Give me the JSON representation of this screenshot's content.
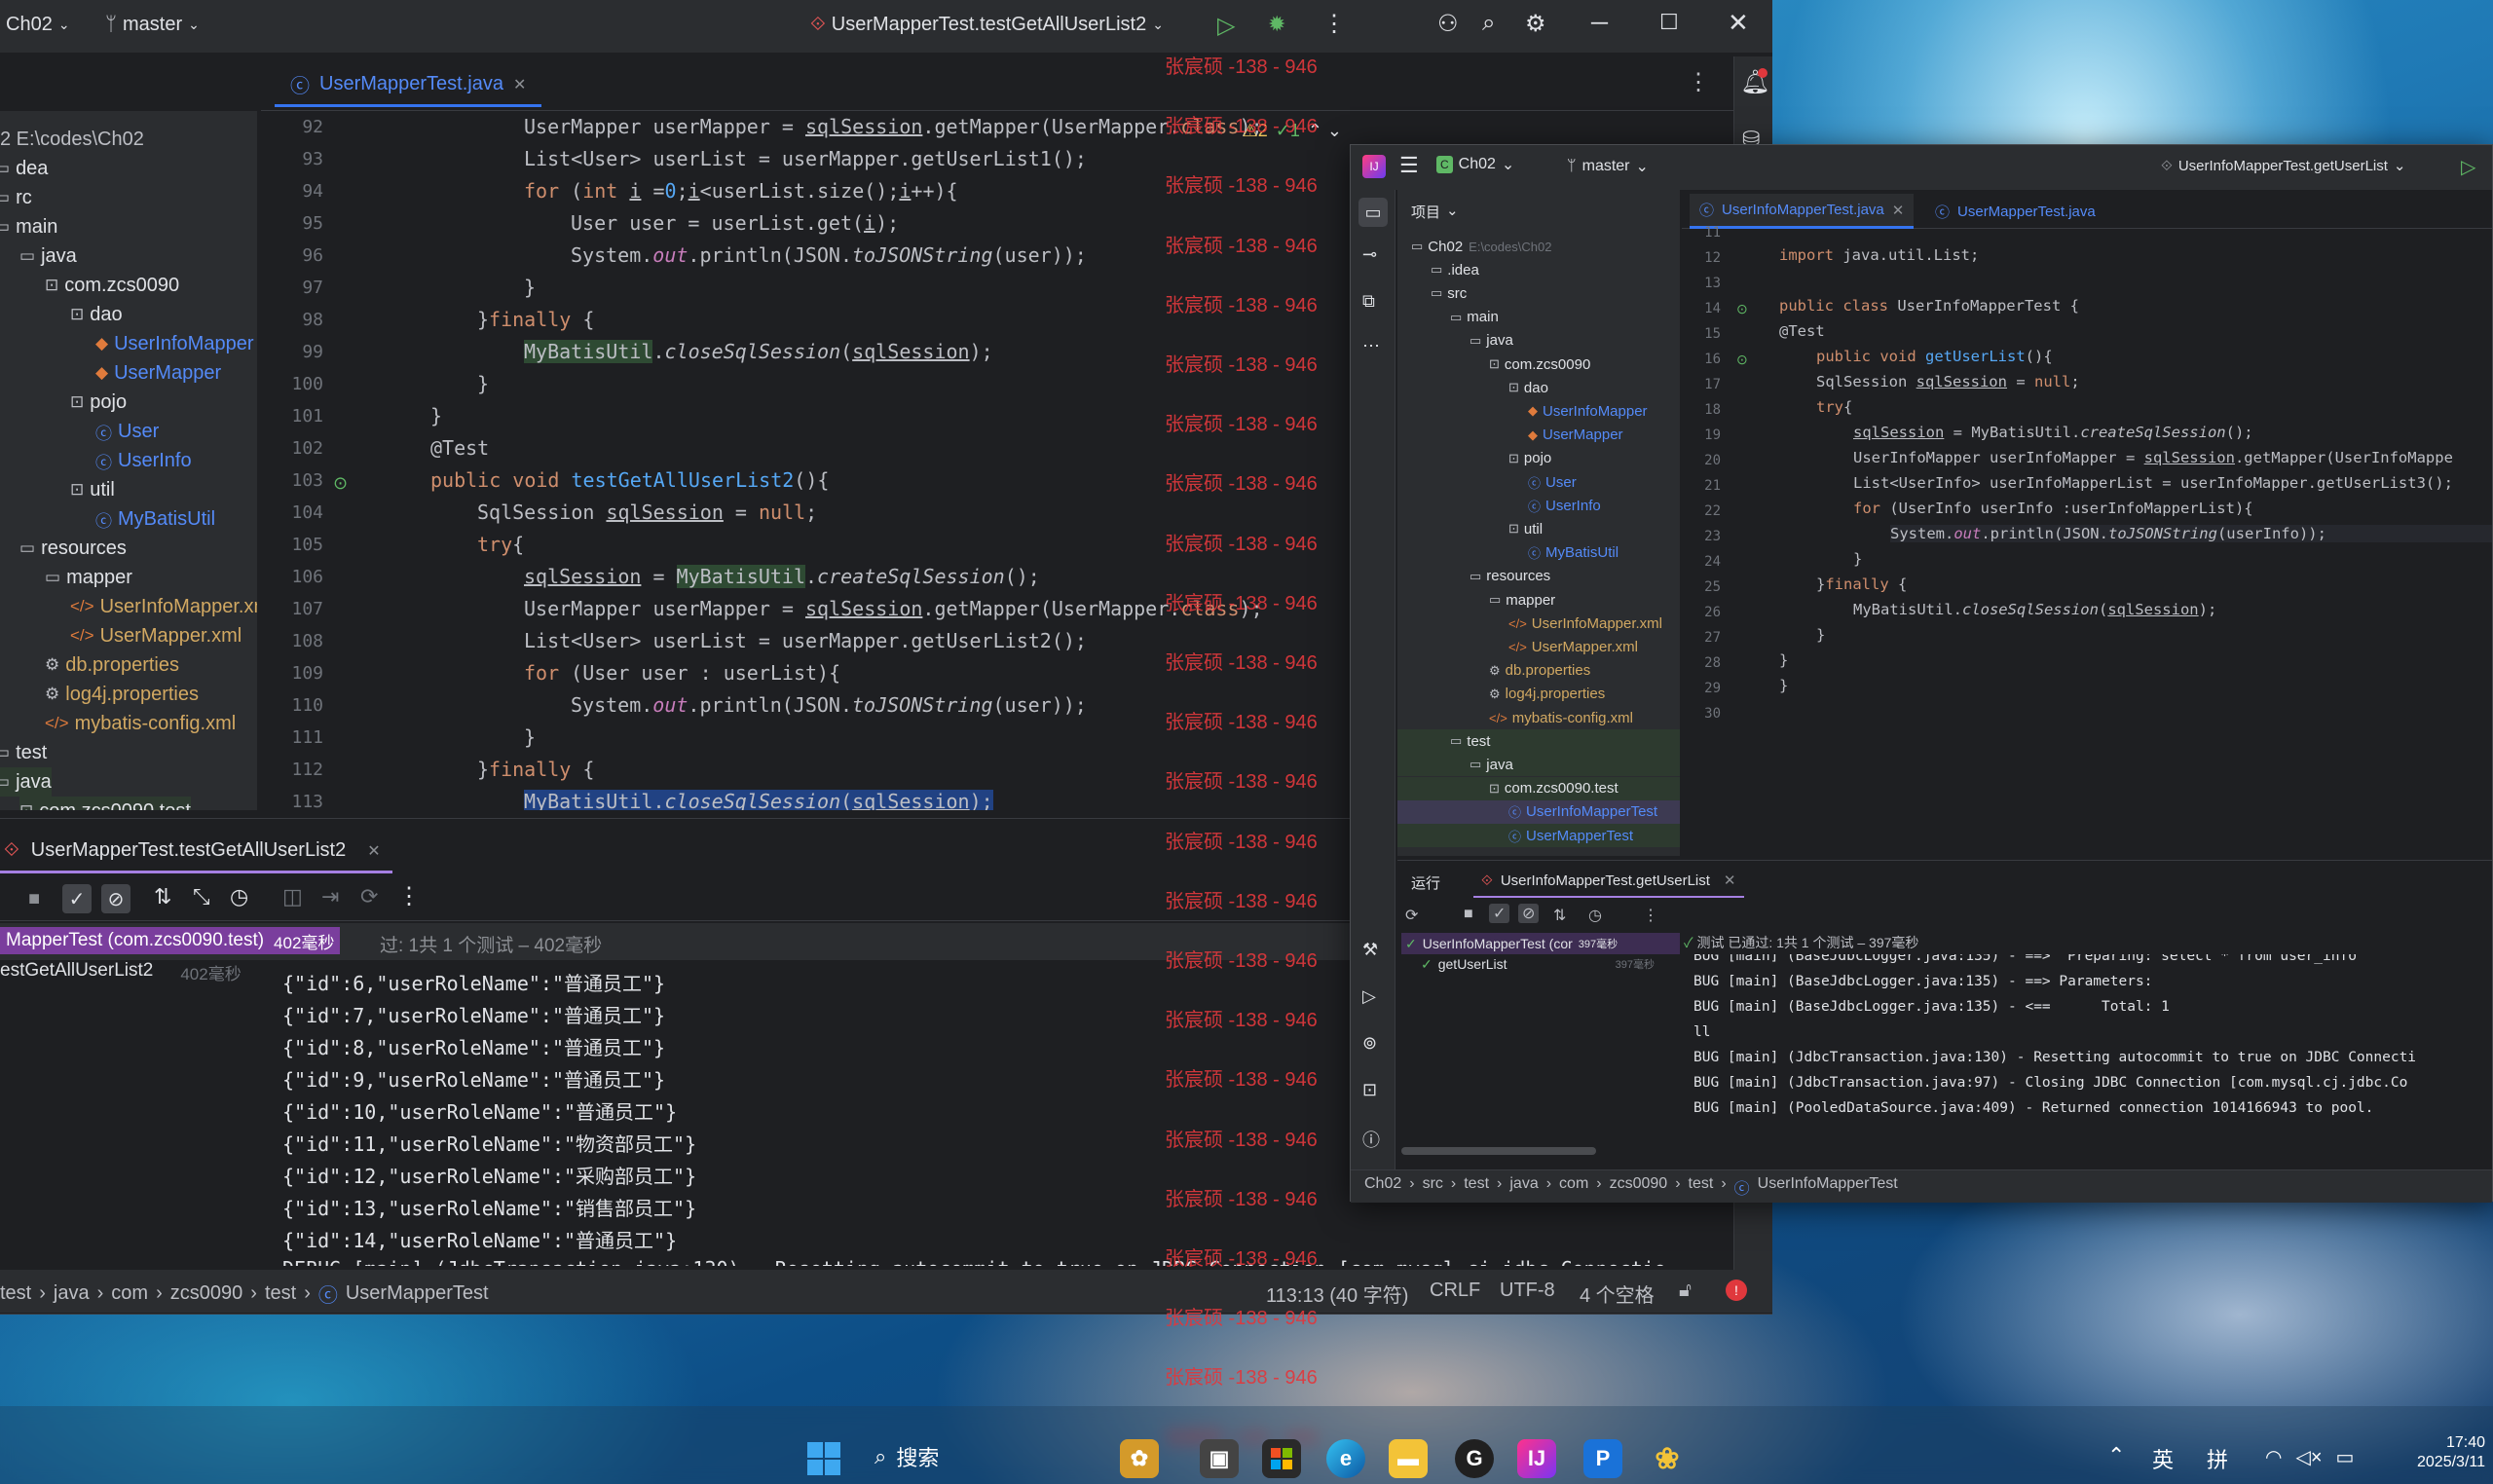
{
  "main_window": {
    "project": "Ch02",
    "branch": "master",
    "run_config": "UserMapperTest.testGetAllUserList2",
    "editor_tab": "UserMapperTest.java",
    "tree": [
      {
        "label": "2  E:\\codes\\Ch02",
        "type": "root"
      },
      {
        "label": "dea",
        "type": "folder"
      },
      {
        "label": "rc",
        "type": "folder"
      },
      {
        "label": "main",
        "type": "folder"
      },
      {
        "label": "java",
        "type": "folder"
      },
      {
        "label": "com.zcs0090",
        "type": "pkg"
      },
      {
        "label": "dao",
        "type": "pkg"
      },
      {
        "label": "UserInfoMapper",
        "type": "mapper"
      },
      {
        "label": "UserMapper",
        "type": "mapper"
      },
      {
        "label": "pojo",
        "type": "pkg"
      },
      {
        "label": "User",
        "type": "class"
      },
      {
        "label": "UserInfo",
        "type": "class"
      },
      {
        "label": "util",
        "type": "pkg"
      },
      {
        "label": "MyBatisUtil",
        "type": "class"
      },
      {
        "label": "resources",
        "type": "folder"
      },
      {
        "label": "mapper",
        "type": "folder"
      },
      {
        "label": "UserInfoMapper.xml",
        "type": "xml"
      },
      {
        "label": "UserMapper.xml",
        "type": "xml"
      },
      {
        "label": "db.properties",
        "type": "prop"
      },
      {
        "label": "log4j.properties",
        "type": "prop"
      },
      {
        "label": "mybatis-config.xml",
        "type": "xml"
      },
      {
        "label": "test",
        "type": "folder"
      },
      {
        "label": "java",
        "type": "folder"
      },
      {
        "label": "com.zcs0090.test",
        "type": "pkg"
      }
    ],
    "line_numbers": [
      "92",
      "93",
      "94",
      "95",
      "96",
      "97",
      "98",
      "99",
      "100",
      "101",
      "102",
      "103",
      "104",
      "105",
      "106",
      "107",
      "108",
      "109",
      "110",
      "111",
      "112",
      "113"
    ],
    "inspection": {
      "warnings": "2",
      "ok": "1"
    },
    "run_tab": "UserMapperTest.testGetAllUserList2",
    "run_tree": [
      {
        "label": "MapperTest (com.zcs0090.test)",
        "time": "402毫秒"
      },
      {
        "label": "estGetAllUserList2",
        "time": "402毫秒"
      }
    ],
    "result_text": "过: 1共 1 个测试 – 402毫秒",
    "console": [
      "{\"id\":6,\"userRoleName\":\"普通员工\"}",
      "{\"id\":7,\"userRoleName\":\"普通员工\"}",
      "{\"id\":8,\"userRoleName\":\"普通员工\"}",
      "{\"id\":9,\"userRoleName\":\"普通员工\"}",
      "{\"id\":10,\"userRoleName\":\"普通员工\"}",
      "{\"id\":11,\"userRoleName\":\"物资部员工\"}",
      "{\"id\":12,\"userRoleName\":\"采购部员工\"}",
      "{\"id\":13,\"userRoleName\":\"销售部员工\"}",
      "{\"id\":14,\"userRoleName\":\"普通员工\"}",
      "DEBUG [main] (JdbcTransaction.java:130) - Resetting autocommit to true on JDBC Connection [com.mysql.cj.jdbc.Connection"
    ],
    "breadcrumb": [
      "test",
      "java",
      "com",
      "zcs0090",
      "test",
      "UserMapperTest"
    ],
    "position": "113:13 (40 字符)",
    "line_sep": "CRLF",
    "encoding": "UTF-8",
    "indent": "4 个空格"
  },
  "watermark": "张宸硕 -138 - 946",
  "second_window": {
    "project": "Ch02",
    "branch": "master",
    "run_config": "UserInfoMapperTest.getUserList",
    "project_label": "项目",
    "tabs": [
      "UserInfoMapperTest.java",
      "UserMapperTest.java"
    ],
    "tree": [
      {
        "label": "Ch02",
        "extra": "E:\\codes\\Ch02"
      },
      {
        "label": ".idea"
      },
      {
        "label": "src"
      },
      {
        "label": "main"
      },
      {
        "label": "java"
      },
      {
        "label": "com.zcs0090"
      },
      {
        "label": "dao"
      },
      {
        "label": "UserInfoMapper"
      },
      {
        "label": "UserMapper"
      },
      {
        "label": "pojo"
      },
      {
        "label": "User"
      },
      {
        "label": "UserInfo"
      },
      {
        "label": "util"
      },
      {
        "label": "MyBatisUtil"
      },
      {
        "label": "resources"
      },
      {
        "label": "mapper"
      },
      {
        "label": "UserInfoMapper.xml"
      },
      {
        "label": "UserMapper.xml"
      },
      {
        "label": "db.properties"
      },
      {
        "label": "log4j.properties"
      },
      {
        "label": "mybatis-config.xml"
      },
      {
        "label": "test"
      },
      {
        "label": "java"
      },
      {
        "label": "com.zcs0090.test"
      },
      {
        "label": "UserInfoMapperTest"
      },
      {
        "label": "UserMapperTest"
      }
    ],
    "line_numbers": [
      "11",
      "12",
      "13",
      "14",
      "15",
      "16",
      "17",
      "18",
      "19",
      "20",
      "21",
      "22",
      "23",
      "24",
      "25",
      "26",
      "27",
      "28",
      "29",
      "30"
    ],
    "run_label": "运行",
    "run_tab": "UserInfoMapperTest.getUserList",
    "run_tree": [
      {
        "label": "UserInfoMapperTest (cor",
        "time": "397毫秒"
      },
      {
        "label": "getUserList",
        "time": "397毫秒"
      }
    ],
    "result_text": "测试 已通过: 1共 1 个测试 – 397毫秒",
    "console": [
      "BUG [main] (BaseJdbcLogger.java:135) - ==>  Preparing: select * from user_info",
      "BUG [main] (BaseJdbcLogger.java:135) - ==> Parameters: ",
      "BUG [main] (BaseJdbcLogger.java:135) - <==      Total: 1",
      "ll",
      "BUG [main] (JdbcTransaction.java:130) - Resetting autocommit to true on JDBC Connecti",
      "BUG [main] (JdbcTransaction.java:97) - Closing JDBC Connection [com.mysql.cj.jdbc.Co",
      "BUG [main] (PooledDataSource.java:409) - Returned connection 1014166943 to pool."
    ],
    "breadcrumb": [
      "Ch02",
      "src",
      "test",
      "java",
      "com",
      "zcs0090",
      "test",
      "UserInfoMapperTest"
    ]
  },
  "taskbar": {
    "search": "搜索",
    "lang": "英",
    "ime": "拼",
    "time": "17:40",
    "date": "2025/3/11"
  }
}
